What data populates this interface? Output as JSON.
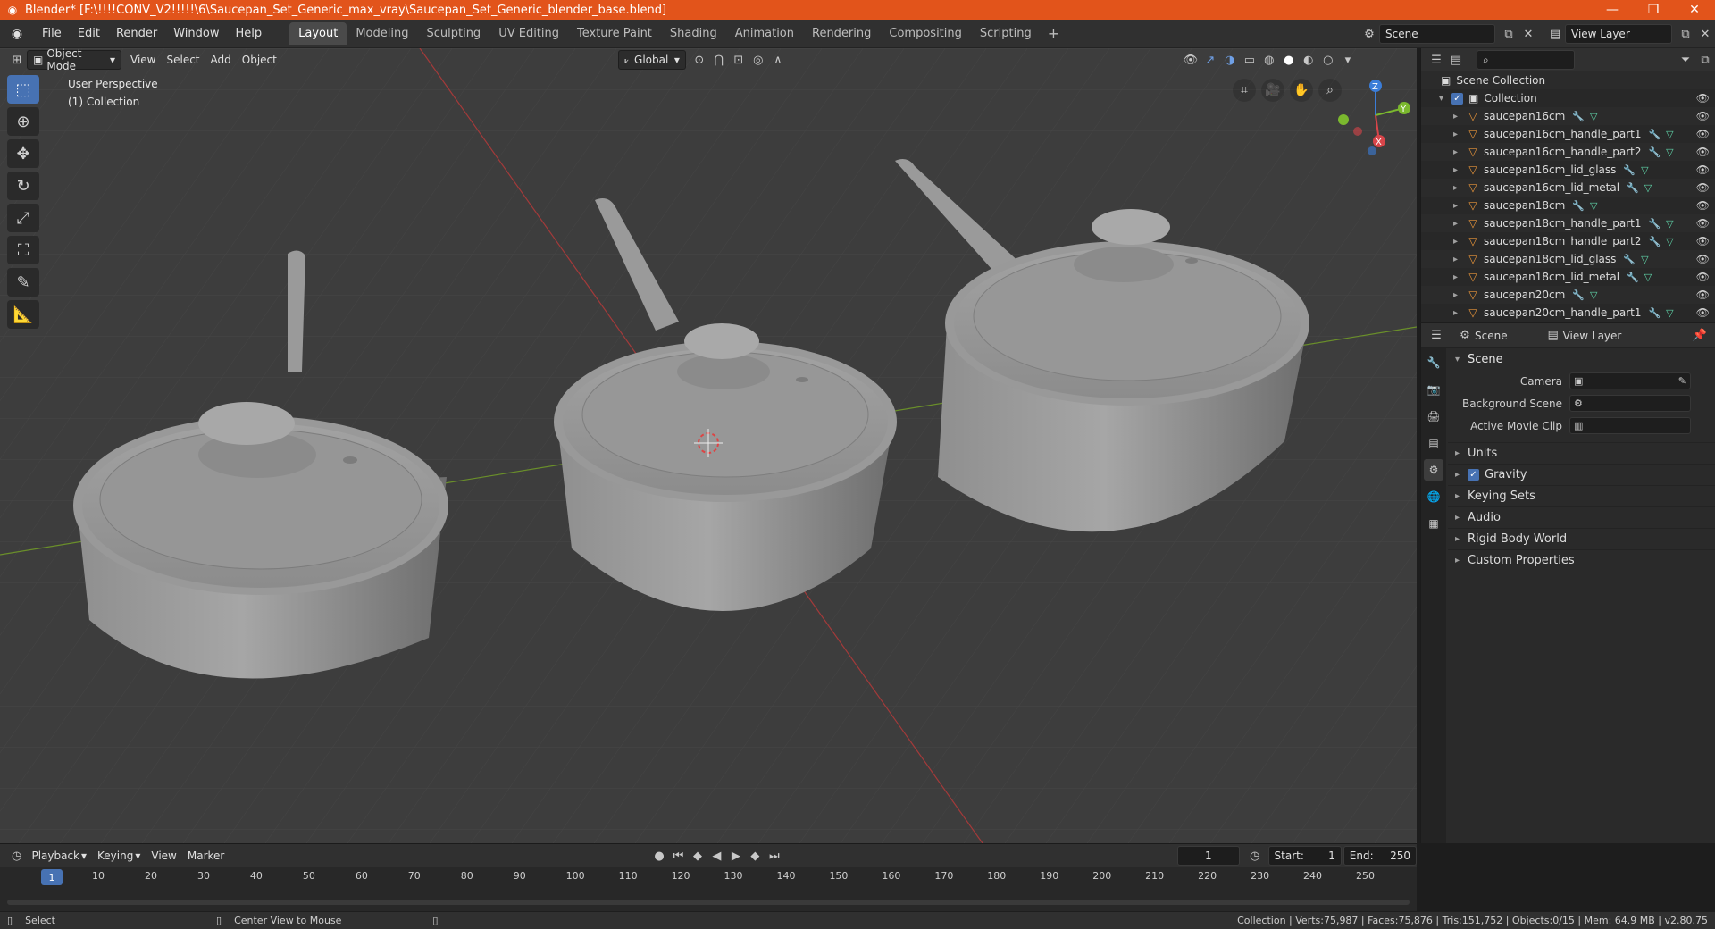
{
  "titlebar": {
    "title": "Blender* [F:\\!!!!CONV_V2!!!!!\\6\\Saucepan_Set_Generic_max_vray\\Saucepan_Set_Generic_blender_base.blend]",
    "minimize": "—",
    "maximize": "❐",
    "close": "✕"
  },
  "menu": [
    "File",
    "Edit",
    "Render",
    "Window",
    "Help"
  ],
  "workspaces": [
    "Layout",
    "Modeling",
    "Sculpting",
    "UV Editing",
    "Texture Paint",
    "Shading",
    "Animation",
    "Rendering",
    "Compositing",
    "Scripting"
  ],
  "scene_field": "Scene",
  "viewlayer_field": "View Layer",
  "viewport": {
    "mode": "Object Mode",
    "menus": [
      "View",
      "Select",
      "Add",
      "Object"
    ],
    "transform": "Global",
    "info_line1": "User Perspective",
    "info_line2": "(1) Collection",
    "gizmo": {
      "z": "Z",
      "y": "Y",
      "x": "X"
    }
  },
  "outliner": {
    "scene_collection": "Scene Collection",
    "collection": "Collection",
    "items": [
      "saucepan16cm",
      "saucepan16cm_handle_part1",
      "saucepan16cm_handle_part2",
      "saucepan16cm_lid_glass",
      "saucepan16cm_lid_metal",
      "saucepan18cm",
      "saucepan18cm_handle_part1",
      "saucepan18cm_handle_part2",
      "saucepan18cm_lid_glass",
      "saucepan18cm_lid_metal",
      "saucepan20cm",
      "saucepan20cm_handle_part1"
    ]
  },
  "properties": {
    "header_scene": "Scene",
    "header_viewlayer": "View Layer",
    "panel": "Scene",
    "camera_label": "Camera",
    "bg_scene_label": "Background Scene",
    "movie_clip_label": "Active Movie Clip",
    "subpanels": [
      "Units",
      "Gravity",
      "Keying Sets",
      "Audio",
      "Rigid Body World",
      "Custom Properties"
    ]
  },
  "timeline": {
    "menus": [
      "Playback",
      "Keying",
      "View",
      "Marker"
    ],
    "current_frame": "1",
    "start_label": "Start:",
    "start": "1",
    "end_label": "End:",
    "end": "250",
    "ticks": [
      "1",
      "10",
      "20",
      "30",
      "40",
      "50",
      "60",
      "70",
      "80",
      "90",
      "100",
      "110",
      "120",
      "130",
      "140",
      "150",
      "160",
      "170",
      "180",
      "190",
      "200",
      "210",
      "220",
      "230",
      "240",
      "250"
    ]
  },
  "status": {
    "left": "Select",
    "middle": "Center View to Mouse",
    "right": "Collection | Verts:75,987 | Faces:75,876 | Tris:151,752 | Objects:0/15 | Mem: 64.9 MB | v2.80.75"
  }
}
